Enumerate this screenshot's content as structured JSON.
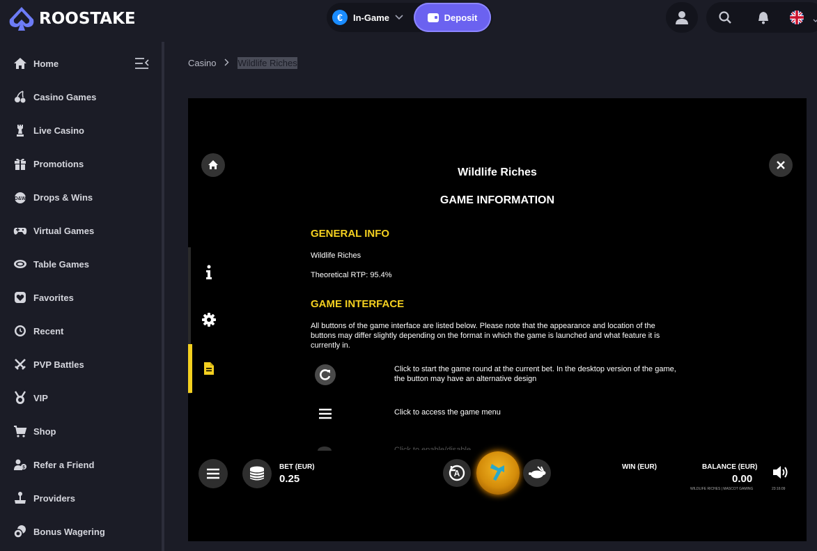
{
  "brand": {
    "name": "ROOSTAKE"
  },
  "wallet": {
    "currency_symbol": "€",
    "label": "In-Game",
    "deposit_label": "Deposit"
  },
  "sidebar": {
    "items": [
      {
        "label": "Home",
        "icon": "home-icon"
      },
      {
        "label": "Casino Games",
        "icon": "cherries-icon"
      },
      {
        "label": "Live Casino",
        "icon": "chess-piece-icon"
      },
      {
        "label": "Promotions",
        "icon": "gift-icon"
      },
      {
        "label": "Drops & Wins",
        "icon": "drops-wins-icon"
      },
      {
        "label": "Virtual Games",
        "icon": "gamepad-icon"
      },
      {
        "label": "Table Games",
        "icon": "table-icon"
      },
      {
        "label": "Favorites",
        "icon": "heart-icon"
      },
      {
        "label": "Recent",
        "icon": "clock-icon"
      },
      {
        "label": "PVP Battles",
        "icon": "swords-icon"
      },
      {
        "label": "VIP",
        "icon": "medal-icon"
      },
      {
        "label": "Shop",
        "icon": "cart-icon"
      },
      {
        "label": "Refer a Friend",
        "icon": "users-icon"
      },
      {
        "label": "Providers",
        "icon": "joystick-icon"
      },
      {
        "label": "Bonus Wagering",
        "icon": "coins-icon"
      }
    ]
  },
  "breadcrumb": {
    "root": "Casino",
    "current": "Wildlife Riches"
  },
  "game": {
    "title": "Wildlife Riches",
    "subtitle": "GAME INFORMATION",
    "general_info_heading": "GENERAL INFO",
    "game_name": "Wildlife Riches",
    "rtp": "Theoretical RTP: 95.4%",
    "interface_heading": "GAME INTERFACE",
    "interface_intro": "All buttons of the game interface are listed below. Please note that the appearance and location of the buttons may differ slightly depending on the format in which the game is launched and what feature it is currently in.",
    "spin_desc": "Click to start the game round at the current bet. In the desktop version of the game, the button may have an alternative design",
    "menu_desc": "Click to access the game menu",
    "turbo_desc_partial": "Click to enable/disable ...",
    "bet_label": "BET (EUR)",
    "bet_value": "0.25",
    "win_label": "WIN (EUR)",
    "balance_label": "BALANCE (EUR)",
    "balance_value": "0.00",
    "footer_brand": "WILDLIFE RICHES | MASCOT GAMING",
    "clock": "23:16:09"
  },
  "colors": {
    "accent_yellow": "#f4d020",
    "deposit": "#6b62f0",
    "background": "#1b1c26"
  }
}
